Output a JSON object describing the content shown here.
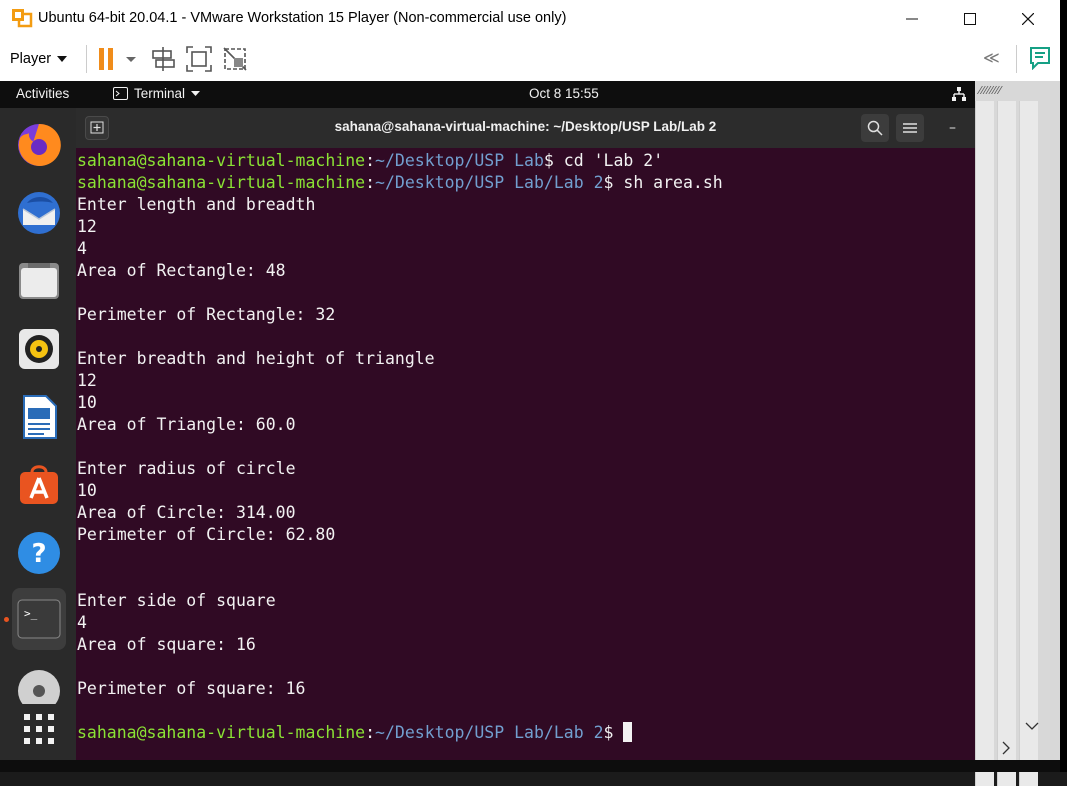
{
  "window": {
    "title": "Ubuntu 64-bit 20.04.1 - VMware Workstation 15 Player (Non-commercial use only)",
    "minimize": "—",
    "maximize": "☐",
    "close": "✕"
  },
  "toolbar": {
    "player_label": "Player",
    "icons": [
      "pause-icon",
      "send-ctrl-alt-del-icon",
      "fit-guest-icon",
      "unity-icon",
      "collapse-icon",
      "message-log-icon"
    ],
    "collapse": "≪"
  },
  "ubuntu_topbar": {
    "activities": "Activities",
    "app_menu": "Terminal",
    "clock": "Oct 8  15:55"
  },
  "dock": {
    "apps": [
      "firefox-icon",
      "thunderbird-icon",
      "files-icon",
      "rhythmbox-icon",
      "libreoffice-writer-icon",
      "ubuntu-software-icon",
      "help-icon",
      "terminal-icon",
      "dvd-icon",
      "show-applications-icon"
    ],
    "active_app": "terminal-icon"
  },
  "terminal": {
    "title": "sahana@sahana-virtual-machine: ~/Desktop/USP Lab/Lab 2",
    "minimize": "–",
    "lines": [
      {
        "type": "prompt",
        "user": "sahana@sahana-virtual-machine",
        "sep": ":",
        "path": "~/Desktop/USP Lab",
        "cmd": "$ cd 'Lab 2'"
      },
      {
        "type": "prompt",
        "user": "sahana@sahana-virtual-machine",
        "sep": ":",
        "path": "~/Desktop/USP Lab/Lab 2",
        "cmd": "$ sh area.sh"
      },
      {
        "type": "out",
        "text": "Enter length and breadth"
      },
      {
        "type": "out",
        "text": "12"
      },
      {
        "type": "out",
        "text": "4"
      },
      {
        "type": "out",
        "text": "Area of Rectangle: 48"
      },
      {
        "type": "out",
        "text": ""
      },
      {
        "type": "out",
        "text": "Perimeter of Rectangle: 32"
      },
      {
        "type": "out",
        "text": ""
      },
      {
        "type": "out",
        "text": "Enter breadth and height of triangle"
      },
      {
        "type": "out",
        "text": "12"
      },
      {
        "type": "out",
        "text": "10"
      },
      {
        "type": "out",
        "text": "Area of Triangle: 60.0"
      },
      {
        "type": "out",
        "text": ""
      },
      {
        "type": "out",
        "text": "Enter radius of circle"
      },
      {
        "type": "out",
        "text": "10"
      },
      {
        "type": "out",
        "text": "Area of Circle: 314.00"
      },
      {
        "type": "out",
        "text": "Perimeter of Circle: 62.80"
      },
      {
        "type": "out",
        "text": ""
      },
      {
        "type": "out",
        "text": ""
      },
      {
        "type": "out",
        "text": "Enter side of square"
      },
      {
        "type": "out",
        "text": "4"
      },
      {
        "type": "out",
        "text": "Area of square: 16"
      },
      {
        "type": "out",
        "text": ""
      },
      {
        "type": "out",
        "text": "Perimeter of square: 16"
      },
      {
        "type": "out",
        "text": ""
      },
      {
        "type": "prompt",
        "user": "sahana@sahana-virtual-machine",
        "sep": ":",
        "path": "~/Desktop/USP Lab/Lab 2",
        "cmd": "$ ",
        "cursor": true
      }
    ]
  },
  "colors": {
    "terminal_bg": "#300a24",
    "prompt_user": "#8ae234",
    "prompt_path": "#729fcf",
    "accent": "#e95420"
  }
}
